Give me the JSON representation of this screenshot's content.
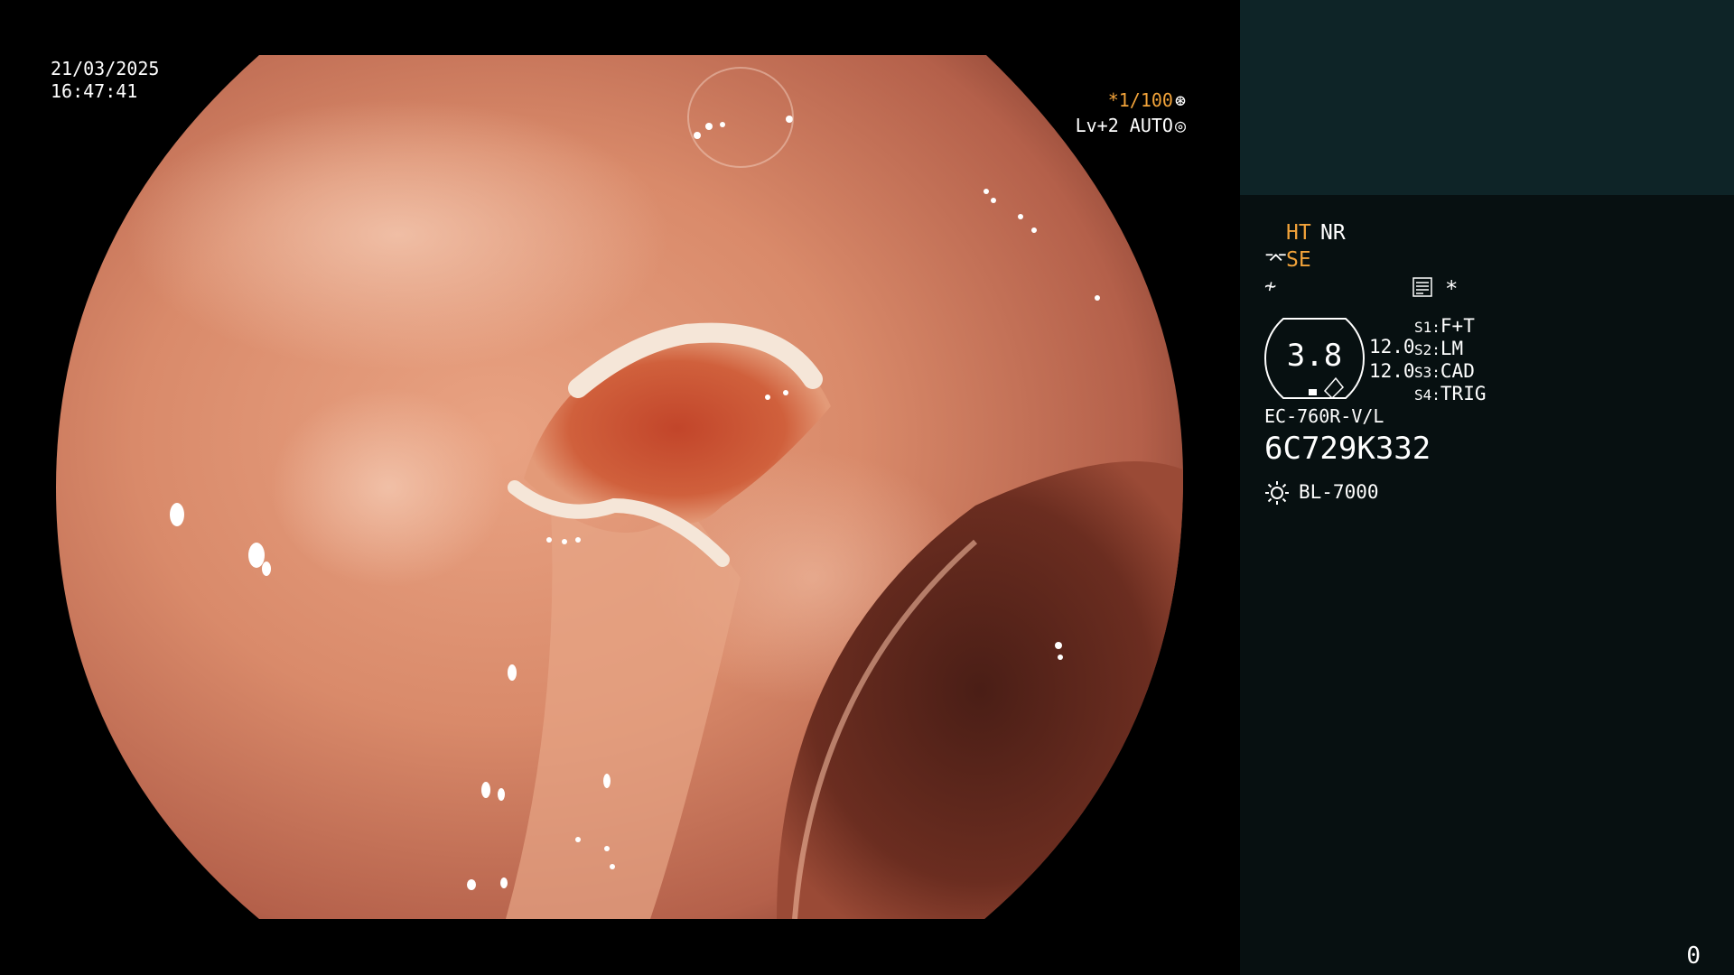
{
  "osd": {
    "date": "21/03/2025",
    "time": "16:47:41",
    "shutter": "*1/100",
    "shutter_icon": "shutter-icon",
    "level": "Lv+2 AUTO",
    "level_icon": "iris-icon"
  },
  "panel": {
    "ht": "HT",
    "nr": "NR",
    "se_icon": "scope-enhance-icon",
    "se": "SE",
    "color_icon": "color-mode-icon",
    "doc_icon": "document-icon",
    "asterisk": "*",
    "gauge_value": "3.8",
    "val1": "12.0",
    "val2": "12.0",
    "switches": [
      {
        "key": "S1:",
        "value": "F+T"
      },
      {
        "key": "S2:",
        "value": "LM"
      },
      {
        "key": "S3:",
        "value": "CAD"
      },
      {
        "key": "S4:",
        "value": "TRIG"
      }
    ],
    "scope_model": "EC-760R-V/L",
    "serial": "6C729K332",
    "light_icon": "light-source-icon",
    "light_model": "BL-7000"
  },
  "counter": "0",
  "colors": {
    "accent": "#f2a33a",
    "panel_bg": "#071011",
    "thumb_bg": "#0e2427",
    "mucosa": "#d98a6a"
  }
}
